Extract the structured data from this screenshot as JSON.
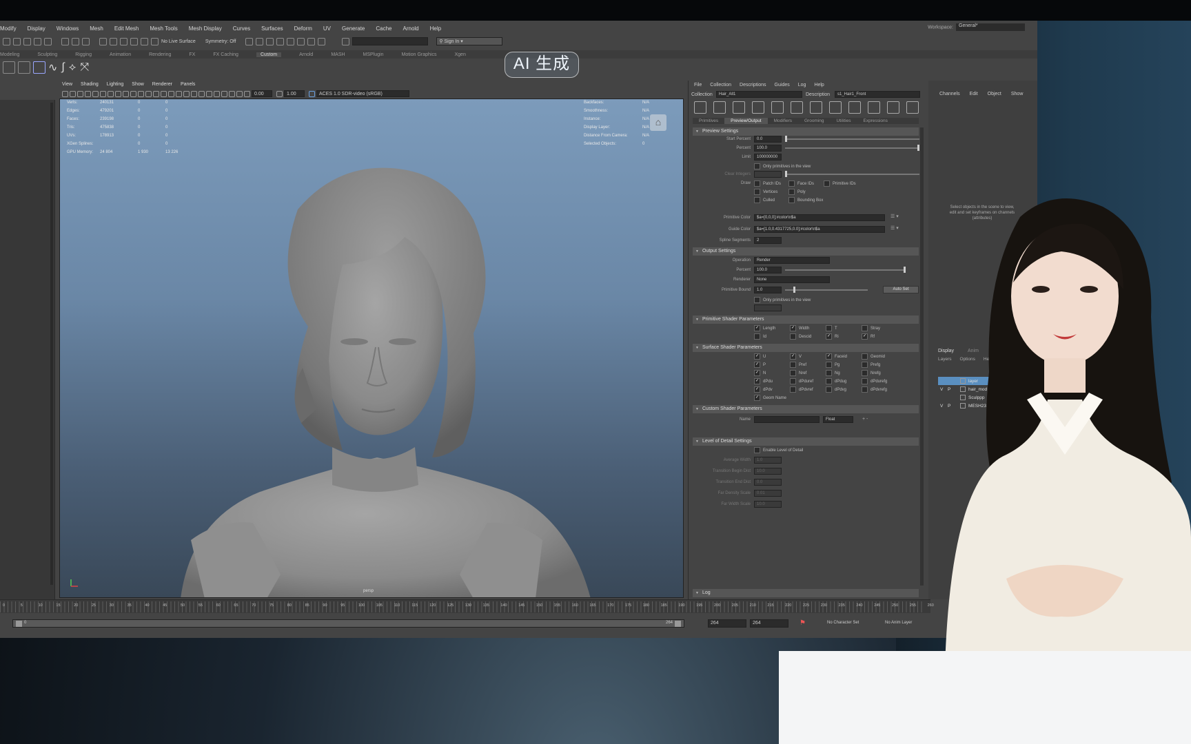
{
  "overlay": {
    "badge_text": "AI 生成"
  },
  "menubar": {
    "items": [
      "Modify",
      "Display",
      "Windows",
      "Mesh",
      "Edit Mesh",
      "Mesh Tools",
      "Mesh Display",
      "Curves",
      "Surfaces",
      "Deform",
      "UV",
      "Generate",
      "Cache",
      "Arnold",
      "Help"
    ],
    "workspace_label": "Workspace:",
    "workspace_value": "General*"
  },
  "statusline": {
    "live_surface": "No Live Surface",
    "symmetry": "Symmetry: Off",
    "sign_in": "Sign In"
  },
  "shelf_tabs": [
    "Modeling",
    "Sculpting",
    "Rigging",
    "Animation",
    "Rendering",
    "FX",
    "FX Caching",
    "Custom",
    "Arnold",
    "MASH",
    "MSPlugin",
    "Motion Graphics",
    "Xgen"
  ],
  "shelf_active": "Custom",
  "viewport": {
    "menu": [
      "View",
      "Shading",
      "Lighting",
      "Show",
      "Renderer",
      "Panels"
    ],
    "exposure": "0.00",
    "gamma": "1.00",
    "color_space": "ACES 1.0 SDR-video (sRGB)",
    "camera": "persp",
    "hud_left": [
      {
        "k": "Verts:",
        "v": "240131",
        "a": "0",
        "b": "0"
      },
      {
        "k": "Edges:",
        "v": "479201",
        "a": "0",
        "b": "0"
      },
      {
        "k": "Faces:",
        "v": "239198",
        "a": "0",
        "b": "0"
      },
      {
        "k": "Tris:",
        "v": "475838",
        "a": "0",
        "b": "0"
      },
      {
        "k": "UVs:",
        "v": "178913",
        "a": "0",
        "b": "0"
      },
      {
        "k": "XGen Splines:",
        "v": "",
        "a": "0",
        "b": "0"
      },
      {
        "k": "GPU Memory:",
        "v": "24 804",
        "a": "1 930",
        "b": "13 226"
      }
    ],
    "hud_right": [
      {
        "k": "Backfaces:",
        "v": "N/A"
      },
      {
        "k": "Smoothness:",
        "v": "N/A"
      },
      {
        "k": "Instance:",
        "v": "N/A"
      },
      {
        "k": "Display Layer:",
        "v": "N/A"
      },
      {
        "k": "Distance From Camera:",
        "v": "N/A"
      },
      {
        "k": "Selected Objects:",
        "v": "0"
      }
    ]
  },
  "xgen": {
    "menu": [
      "File",
      "Collection",
      "Descriptions",
      "Guides",
      "Log",
      "Help"
    ],
    "collection_label": "Collection",
    "collection_value": "Hair_All1",
    "description_label": "Description",
    "description_value": "s1_Hair1_Front",
    "tabs": [
      "Primitives",
      "Preview/Output",
      "Modifiers",
      "Grooming",
      "Utilities",
      "Expressions"
    ],
    "active_tab": "Preview/Output",
    "preview": {
      "title": "Preview Settings",
      "start_percent_label": "Start Percent",
      "start_percent": "0.0",
      "percent_label": "Percent",
      "percent": "100.0",
      "limit_label": "Limit",
      "limit": "100000000",
      "only_prims": "Only primitives in the view",
      "clear_label": "Clear Integers",
      "draw_label": "Draw",
      "draw_opts": [
        "Patch IDs",
        "Face IDs",
        "Primitive IDs",
        "Vertices",
        "Poly",
        "Culled",
        "Bounding Box"
      ],
      "prim_color_label": "Primitive Color",
      "prim_color": "$a=[0,0,0];#color\\n$a",
      "guide_color_label": "Guide Color",
      "guide_color": "$a=[1.0,0.4317725,0.0];#color\\n$a",
      "spline_label": "Spline Segments",
      "spline": "2"
    },
    "output": {
      "title": "Output Settings",
      "operation_label": "Operation",
      "operation": "Render",
      "percent_label": "Percent",
      "percent": "100.0",
      "renderer_label": "Renderer",
      "renderer": "None",
      "bound_label": "Primitive Bound",
      "bound": "1.0",
      "auto_set": "Auto Set",
      "only_prims": "Only primitives in the view"
    },
    "prim_shader": {
      "title": "Primitive Shader Parameters",
      "items": [
        {
          "t": "Length",
          "on": true
        },
        {
          "t": "Width",
          "on": true
        },
        {
          "t": "T",
          "on": false
        },
        {
          "t": "Stray",
          "on": false
        },
        {
          "t": "Id",
          "on": false
        },
        {
          "t": "Descid",
          "on": false
        },
        {
          "t": "Ri",
          "on": true
        },
        {
          "t": "Rf",
          "on": true
        }
      ]
    },
    "surf_shader": {
      "title": "Surface Shader Parameters",
      "items": [
        {
          "t": "U",
          "on": true
        },
        {
          "t": "V",
          "on": true
        },
        {
          "t": "Faceid",
          "on": true
        },
        {
          "t": "Geomid",
          "on": false
        },
        {
          "t": "P",
          "on": true
        },
        {
          "t": "Pref",
          "on": false
        },
        {
          "t": "Pg",
          "on": false
        },
        {
          "t": "Prefg",
          "on": false
        },
        {
          "t": "N",
          "on": true
        },
        {
          "t": "Nref",
          "on": false
        },
        {
          "t": "Ng",
          "on": false
        },
        {
          "t": "Nrefg",
          "on": false
        },
        {
          "t": "dPdu",
          "on": true
        },
        {
          "t": "dPduref",
          "on": false
        },
        {
          "t": "dPdug",
          "on": false
        },
        {
          "t": "dPdurefg",
          "on": false
        },
        {
          "t": "dPdv",
          "on": true
        },
        {
          "t": "dPdvref",
          "on": false
        },
        {
          "t": "dPdvg",
          "on": false
        },
        {
          "t": "dPdvrefg",
          "on": false
        },
        {
          "t": "Geom Name",
          "on": true
        }
      ]
    },
    "custom_shader": {
      "title": "Custom Shader Parameters",
      "name_label": "Name",
      "type": "Float"
    },
    "lod": {
      "title": "Level of Detail Settings",
      "enable": "Enable Level of Detail",
      "rows": [
        {
          "k": "Average Width",
          "v": "1.0"
        },
        {
          "k": "Transition Begin Dist",
          "v": "10.0"
        },
        {
          "k": "Transition End Dist",
          "v": "0.0"
        },
        {
          "k": "Far Density Scale",
          "v": "0.01"
        },
        {
          "k": "Far Width Scale",
          "v": "10.0"
        }
      ]
    },
    "log_label": "Log"
  },
  "channel_box": {
    "menu": [
      "Channels",
      "Edit",
      "Object",
      "Show"
    ],
    "hint": "Select objects in the scene to view, edit and set keyframes on channels (attributes)",
    "layer_tabs": [
      "Display",
      "Anim"
    ],
    "layer_menu": [
      "Layers",
      "Options",
      "Help"
    ],
    "layers": [
      {
        "v": "",
        "p": "",
        "name": "layer",
        "selected": true
      },
      {
        "v": "V",
        "p": "P",
        "name": "hair_mod",
        "selected": false
      },
      {
        "v": "",
        "p": "",
        "name": "Sculppp",
        "selected": false
      },
      {
        "v": "V",
        "p": "P",
        "name": "MESH231",
        "selected": false
      }
    ]
  },
  "range": {
    "start": "0",
    "end_a": "264",
    "end_b": "264",
    "end_c": "264",
    "character_set": "No Character Set",
    "anim_layer": "No Anim Layer"
  },
  "timeline_ticks": [
    "0",
    "5",
    "10",
    "15",
    "20",
    "25",
    "30",
    "35",
    "40",
    "45",
    "50",
    "55",
    "60",
    "65",
    "70",
    "75",
    "80",
    "85",
    "90",
    "95",
    "100",
    "105",
    "110",
    "115",
    "120",
    "125",
    "130",
    "135",
    "140",
    "145",
    "150",
    "155",
    "160",
    "165",
    "170",
    "175",
    "180",
    "185",
    "190",
    "195",
    "200",
    "205",
    "210",
    "215",
    "220",
    "225",
    "230",
    "235",
    "240",
    "245",
    "250",
    "255",
    "260"
  ]
}
